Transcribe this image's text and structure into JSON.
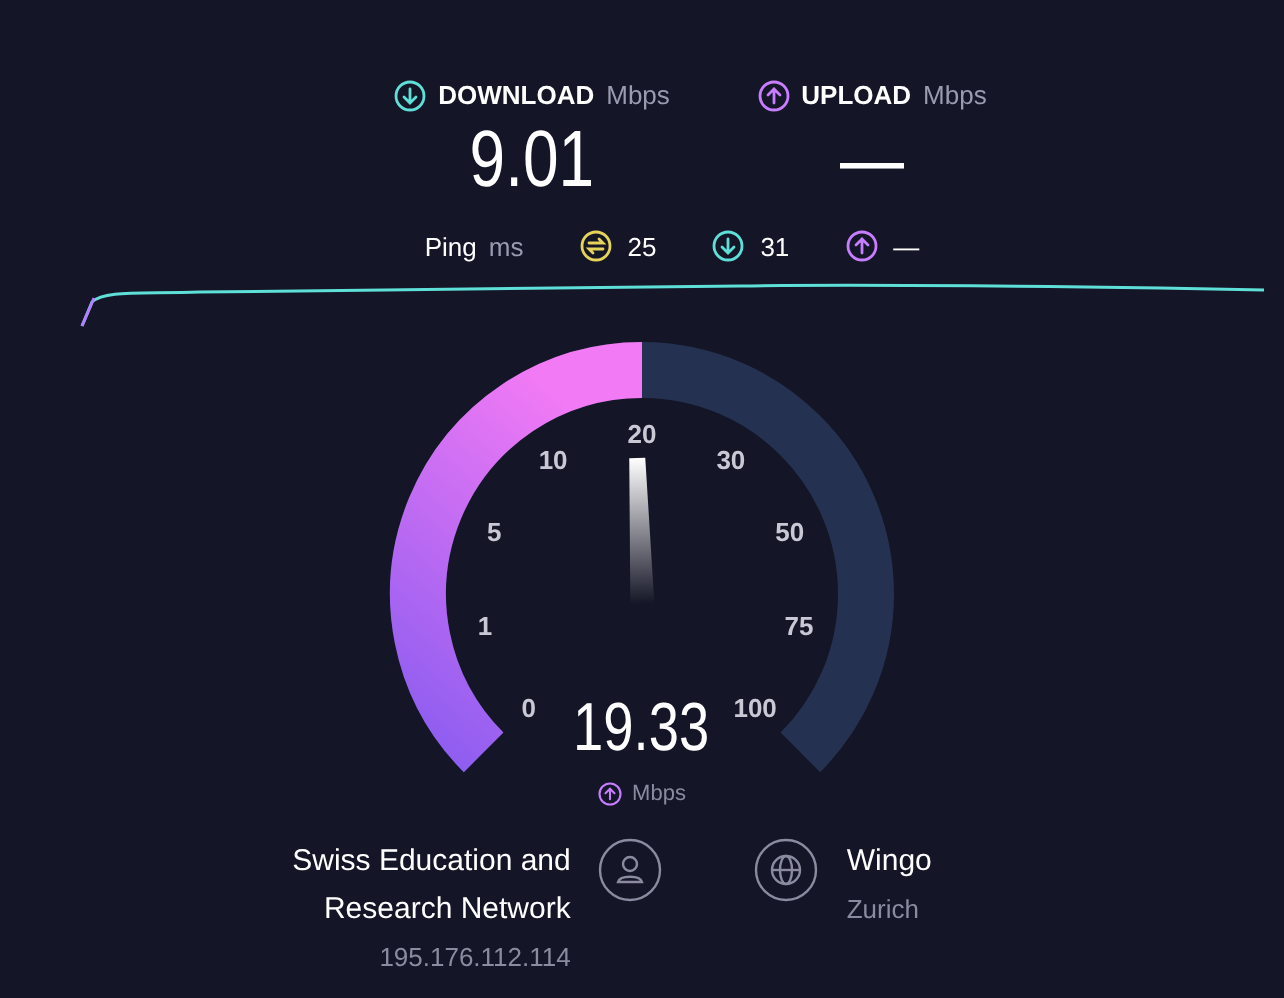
{
  "download": {
    "label": "DOWNLOAD",
    "unit": "Mbps",
    "value": "9.01"
  },
  "upload": {
    "label": "UPLOAD",
    "unit": "Mbps",
    "value": "—"
  },
  "ping": {
    "label": "Ping",
    "unit": "ms",
    "readings": [
      {
        "kind": "idle",
        "value": "25"
      },
      {
        "kind": "download",
        "value": "31"
      },
      {
        "kind": "upload",
        "value": "—"
      }
    ]
  },
  "gauge": {
    "ticks": [
      "0",
      "1",
      "5",
      "10",
      "20",
      "30",
      "50",
      "75",
      "100"
    ],
    "value": "19.33",
    "unit": "Mbps"
  },
  "client": {
    "provider_lines": [
      "Swiss Education and",
      "Research Network"
    ],
    "ip": "195.176.112.114"
  },
  "server": {
    "name": "Wingo",
    "location": "Zurich"
  }
}
